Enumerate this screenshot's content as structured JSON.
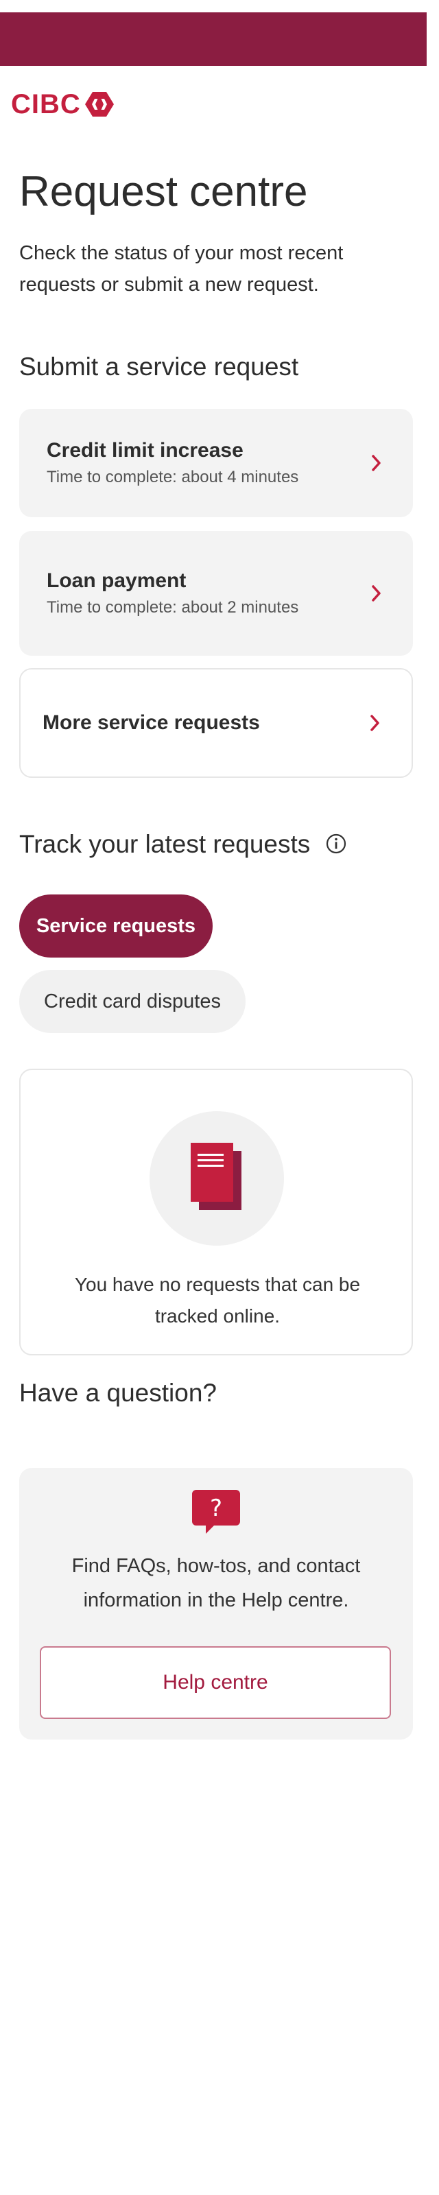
{
  "brand": {
    "name": "CIBC",
    "topbar_color": "#8b1d41",
    "logo_color": "#c41f3e"
  },
  "header": {
    "title": "Request centre",
    "description": "Check the status of your most recent requests or submit a new request."
  },
  "submit_section": {
    "heading": "Submit a service request",
    "cards": [
      {
        "title": "Credit limit increase",
        "subtitle": "Time to complete: about 4 minutes",
        "icon": "chevron-right-icon"
      },
      {
        "title": "Loan payment",
        "subtitle": "Time to complete: about 2 minutes",
        "icon": "chevron-right-icon"
      },
      {
        "title": "More service requests",
        "icon": "chevron-right-icon"
      }
    ]
  },
  "track_section": {
    "heading": "Track your latest requests",
    "info_icon": "info-icon",
    "tabs": [
      {
        "label": "Service requests",
        "selected": true
      },
      {
        "label": "Credit card disputes",
        "selected": false
      }
    ],
    "empty_state": {
      "icon": "documents-icon",
      "message": "You have no requests that can be tracked online."
    }
  },
  "help_section": {
    "heading": "Have a question?",
    "icon": "question-bubble-icon",
    "text": "Find FAQs, how-tos, and contact information in the Help centre.",
    "button_label": "Help centre"
  },
  "colors": {
    "accent": "#c41f3e",
    "dark_accent": "#8b1d41",
    "card_background": "#f3f3f3"
  }
}
